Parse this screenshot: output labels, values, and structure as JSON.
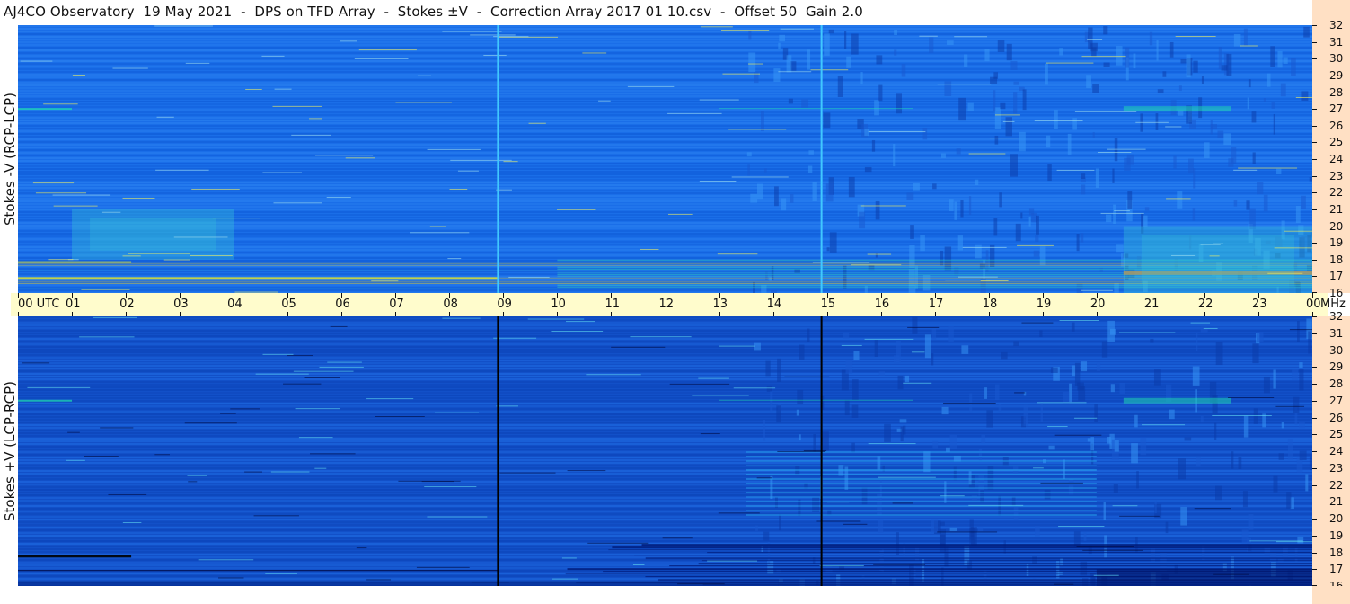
{
  "title": "AJ4CO Observatory  19 May 2021  -  DPS on TFD Array  -  Stokes ±V  -  Correction Array 2017 01 10.csv  -  Offset 50  Gain 2.0",
  "chart_data": [
    {
      "type": "heatmap",
      "ylabel": "Stokes -V (RCP-LCP)",
      "x": {
        "labels": [
          "00",
          "01",
          "02",
          "03",
          "04",
          "05",
          "06",
          "07",
          "08",
          "09",
          "10",
          "11",
          "12",
          "13",
          "14",
          "15",
          "16",
          "17",
          "18",
          "19",
          "20",
          "21",
          "22",
          "23",
          "00"
        ],
        "first_label": "00  UTC",
        "range": [
          0,
          24
        ]
      },
      "y": {
        "labels": [
          "16",
          "17",
          "18",
          "19",
          "20",
          "21",
          "22",
          "23",
          "24",
          "25",
          "26",
          "27",
          "28",
          "29",
          "30",
          "31",
          "32"
        ],
        "unit": "MHz",
        "range": [
          16,
          32
        ]
      },
      "background_color": "#1a6ee8",
      "features": [
        {
          "kind": "vertical_line",
          "time_utc": 8.9,
          "color": "#40c8ff"
        },
        {
          "kind": "vertical_line",
          "time_utc": 14.9,
          "color": "#40c8ff"
        },
        {
          "kind": "intense_band",
          "freq_mhz": [
            16.2,
            18.0
          ],
          "color": "#c8e838"
        },
        {
          "kind": "diffuse_patch",
          "time_utc": [
            1.0,
            4.0
          ],
          "freq_mhz": [
            18.0,
            21.0
          ],
          "color": "#38c8d8"
        },
        {
          "kind": "diffuse_patch",
          "time_utc": [
            20.5,
            24.0
          ],
          "freq_mhz": [
            16.0,
            20.0
          ],
          "color": "#38c8d8"
        },
        {
          "kind": "rfi_line",
          "freq_mhz": 27.0,
          "time_utc": [
            0.0,
            24.0
          ],
          "color": "#20e0b0"
        }
      ]
    },
    {
      "type": "heatmap",
      "ylabel": "Stokes +V (LCP-RCP)",
      "x": {
        "labels": [
          "00",
          "01",
          "02",
          "03",
          "04",
          "05",
          "06",
          "07",
          "08",
          "09",
          "10",
          "11",
          "12",
          "13",
          "14",
          "15",
          "16",
          "17",
          "18",
          "19",
          "20",
          "21",
          "22",
          "23",
          "00"
        ],
        "range": [
          0,
          24
        ]
      },
      "y": {
        "labels": [
          "16",
          "17",
          "18",
          "19",
          "20",
          "21",
          "22",
          "23",
          "24",
          "25",
          "26",
          "27",
          "28",
          "29",
          "30",
          "31",
          "32"
        ],
        "unit": "MHz",
        "range": [
          16,
          32
        ]
      },
      "background_color": "#1250c8",
      "features": [
        {
          "kind": "vertical_line",
          "time_utc": 8.9,
          "color": "#000000"
        },
        {
          "kind": "vertical_line",
          "time_utc": 14.9,
          "color": "#000000"
        },
        {
          "kind": "dark_band",
          "freq_mhz": [
            16.0,
            18.5
          ],
          "color": "#001a78"
        },
        {
          "kind": "bright_band",
          "freq_mhz": [
            20.0,
            24.0
          ],
          "time_utc": [
            13.5,
            20.0
          ],
          "color": "#28a8f0"
        },
        {
          "kind": "rfi_line",
          "freq_mhz": 27.0,
          "time_utc": [
            0.0,
            24.0
          ],
          "color": "#20e0b0"
        }
      ]
    }
  ],
  "colors": {
    "time_axis_bg": "#fffccc",
    "freq_axis_bg": "#ffe0c4",
    "top_field": "#1a6ee8",
    "bottom_field": "#1250c8"
  }
}
